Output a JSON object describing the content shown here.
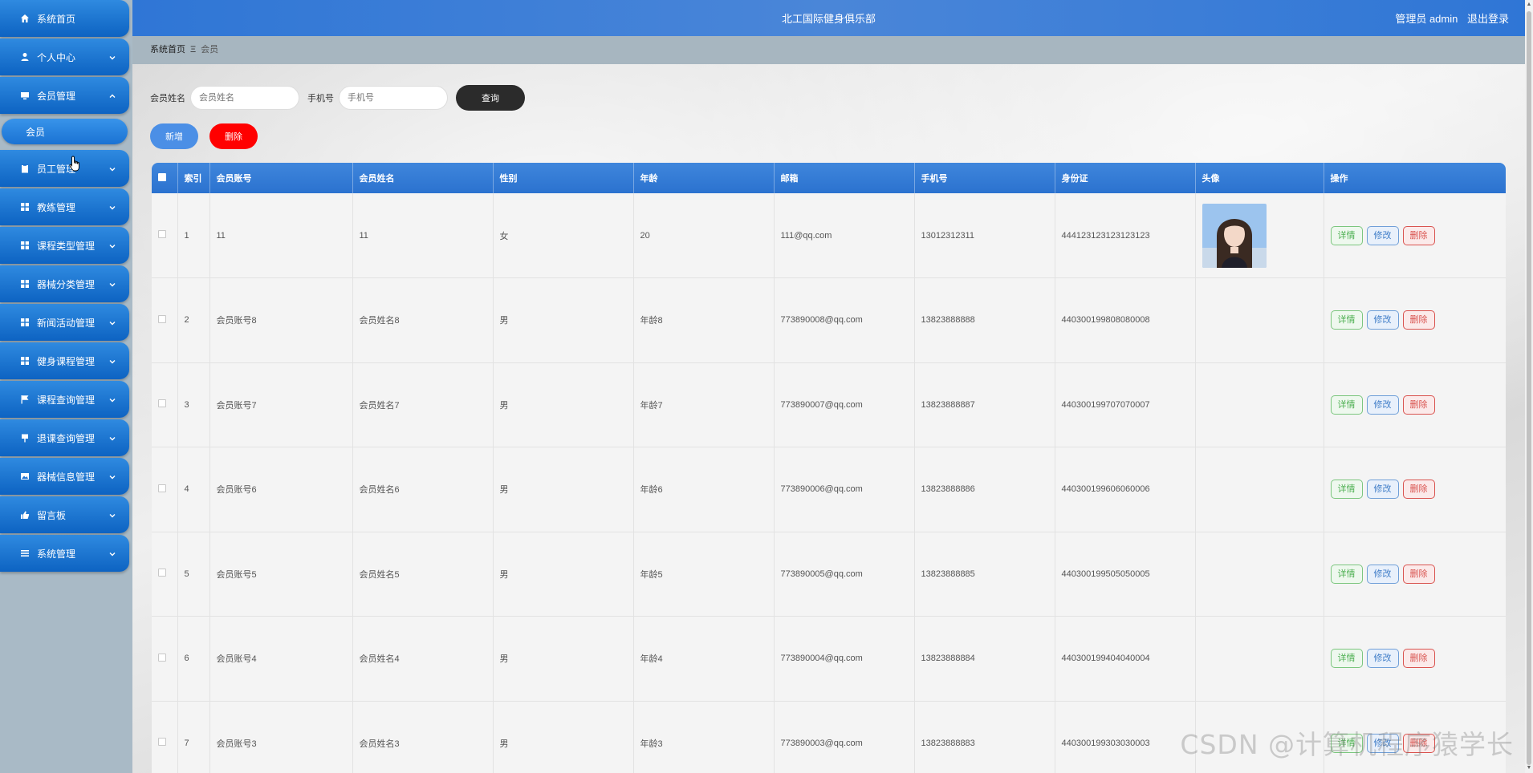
{
  "header": {
    "title": "北工国际健身俱乐部",
    "user_label": "管理员 admin",
    "logout": "退出登录"
  },
  "breadcrumb": {
    "home": "系统首页",
    "separator": "Ξ",
    "current": "会员"
  },
  "sidebar": {
    "items": [
      {
        "label": "系统首页",
        "icon": "home-icon"
      },
      {
        "label": "个人中心",
        "icon": "user-icon"
      },
      {
        "label": "会员管理",
        "icon": "monitor-icon",
        "expanded": true
      },
      {
        "label": "员工管理",
        "icon": "clipboard-icon"
      },
      {
        "label": "教练管理",
        "icon": "grid-icon"
      },
      {
        "label": "课程类型管理",
        "icon": "grid-icon"
      },
      {
        "label": "器械分类管理",
        "icon": "grid-icon"
      },
      {
        "label": "新闻活动管理",
        "icon": "grid-icon"
      },
      {
        "label": "健身课程管理",
        "icon": "grid-icon"
      },
      {
        "label": "课程查询管理",
        "icon": "flag-icon"
      },
      {
        "label": "退课查询管理",
        "icon": "pin-icon"
      },
      {
        "label": "器械信息管理",
        "icon": "image-icon"
      },
      {
        "label": "留言板",
        "icon": "thumb-icon"
      },
      {
        "label": "系统管理",
        "icon": "list-icon"
      }
    ],
    "sub_item": "会员"
  },
  "search": {
    "name_label": "会员姓名",
    "name_placeholder": "会员姓名",
    "phone_label": "手机号",
    "phone_placeholder": "手机号",
    "query_button": "查询"
  },
  "actions": {
    "add": "新增",
    "delete": "删除"
  },
  "table": {
    "columns": [
      "索引",
      "会员账号",
      "会员姓名",
      "性别",
      "年龄",
      "邮箱",
      "手机号",
      "身份证",
      "头像",
      "操作"
    ],
    "row_actions": {
      "detail": "详情",
      "edit": "修改",
      "remove": "删除"
    },
    "rows": [
      {
        "index": "1",
        "account": "11",
        "name": "11",
        "gender": "女",
        "age": "20",
        "email": "111@qq.com",
        "phone": "13012312311",
        "idcard": "444123123123123123",
        "has_avatar": true
      },
      {
        "index": "2",
        "account": "会员账号8",
        "name": "会员姓名8",
        "gender": "男",
        "age": "年龄8",
        "email": "773890008@qq.com",
        "phone": "13823888888",
        "idcard": "440300199808080008",
        "has_avatar": false
      },
      {
        "index": "3",
        "account": "会员账号7",
        "name": "会员姓名7",
        "gender": "男",
        "age": "年龄7",
        "email": "773890007@qq.com",
        "phone": "13823888887",
        "idcard": "440300199707070007",
        "has_avatar": false
      },
      {
        "index": "4",
        "account": "会员账号6",
        "name": "会员姓名6",
        "gender": "男",
        "age": "年龄6",
        "email": "773890006@qq.com",
        "phone": "13823888886",
        "idcard": "440300199606060006",
        "has_avatar": false
      },
      {
        "index": "5",
        "account": "会员账号5",
        "name": "会员姓名5",
        "gender": "男",
        "age": "年龄5",
        "email": "773890005@qq.com",
        "phone": "13823888885",
        "idcard": "440300199505050005",
        "has_avatar": false
      },
      {
        "index": "6",
        "account": "会员账号4",
        "name": "会员姓名4",
        "gender": "男",
        "age": "年龄4",
        "email": "773890004@qq.com",
        "phone": "13823888884",
        "idcard": "440300199404040004",
        "has_avatar": false
      },
      {
        "index": "7",
        "account": "会员账号3",
        "name": "会员姓名3",
        "gender": "男",
        "age": "年龄3",
        "email": "773890003@qq.com",
        "phone": "13823888883",
        "idcard": "440300199303030003",
        "has_avatar": false
      }
    ]
  },
  "watermark": "CSDN @计算机程序猿学长",
  "colors": {
    "primary": "#2f76d6",
    "danger": "#ff0000",
    "dark_button": "#2b2b2b"
  }
}
